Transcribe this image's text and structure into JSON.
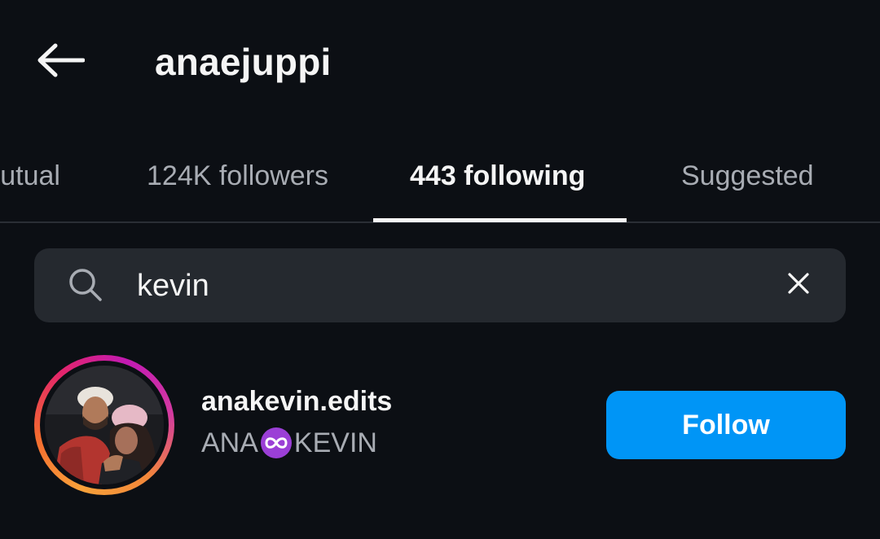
{
  "header": {
    "back_icon": "arrow-left-icon",
    "title": "anaejuppi"
  },
  "tabs": [
    {
      "label": "Mutual",
      "active": false
    },
    {
      "label": "124K followers",
      "active": false
    },
    {
      "label": "443 following",
      "active": true
    },
    {
      "label": "Suggested",
      "active": false
    }
  ],
  "search": {
    "icon": "search-icon",
    "value": "kevin",
    "clear_icon": "close-icon"
  },
  "results": [
    {
      "username": "anakevin.edits",
      "fullname_left": "ANA",
      "fullname_emoji": "infinity-emoji",
      "fullname_right": "KEVIN",
      "button_label": "Follow"
    }
  ],
  "colors": {
    "background": "#0c0f14",
    "search_bg": "#25292f",
    "follow_button": "#0095f6",
    "muted_text": "#a8acb3",
    "primary_text": "#f5f5f5"
  }
}
